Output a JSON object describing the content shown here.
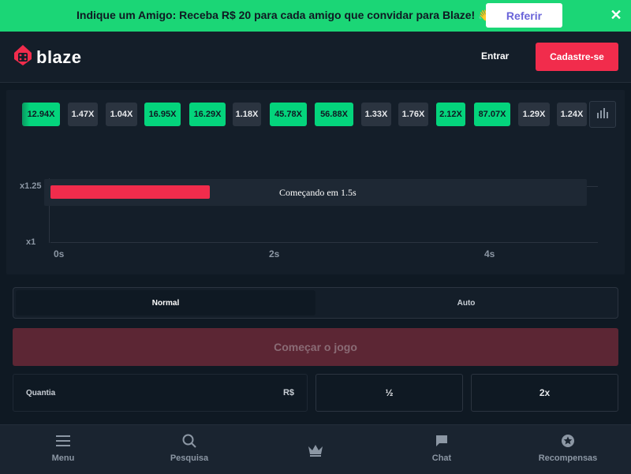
{
  "promo": {
    "text": "Indique um Amigo: Receba R$ 20 para cada amigo que convidar para Blaze! 👋",
    "button": "Referir",
    "close": "✕"
  },
  "header": {
    "brand": "blaze",
    "login": "Entrar",
    "signup": "Cadastre-se"
  },
  "history": [
    {
      "value": "12.94X",
      "color": "green"
    },
    {
      "value": "1.47X",
      "color": "gray"
    },
    {
      "value": "1.04X",
      "color": "gray"
    },
    {
      "value": "16.95X",
      "color": "green"
    },
    {
      "value": "16.29X",
      "color": "green"
    },
    {
      "value": "1.18X",
      "color": "gray"
    },
    {
      "value": "45.78X",
      "color": "green"
    },
    {
      "value": "56.88X",
      "color": "green"
    },
    {
      "value": "1.33X",
      "color": "gray"
    },
    {
      "value": "1.76X",
      "color": "gray"
    },
    {
      "value": "2.12X",
      "color": "green"
    },
    {
      "value": "87.07X",
      "color": "green"
    },
    {
      "value": "1.29X",
      "color": "gray"
    },
    {
      "value": "1.24X",
      "color": "gray"
    }
  ],
  "graph": {
    "y_labels": [
      "x1.25",
      "x1"
    ],
    "x_labels": [
      "0s",
      "2s",
      "4s"
    ],
    "status": "Começando em 1.5s",
    "progress": 0.3
  },
  "modes": {
    "normal": "Normal",
    "auto": "Auto",
    "selected": "Normal"
  },
  "start_button": "Começar o jogo",
  "bet": {
    "amount_label": "Quantia",
    "currency": "R$",
    "amount_value": "",
    "half": "½",
    "double": "2x"
  },
  "nav": {
    "menu": "Menu",
    "search": "Pesquisa",
    "chat": "Chat",
    "rewards": "Recompensas"
  },
  "colors": {
    "promo_bg": "#1bd676",
    "accent_red": "#f12c4c",
    "chip_green": "#04d47c",
    "chip_gray": "#2b3440",
    "background": "#0f1923"
  }
}
